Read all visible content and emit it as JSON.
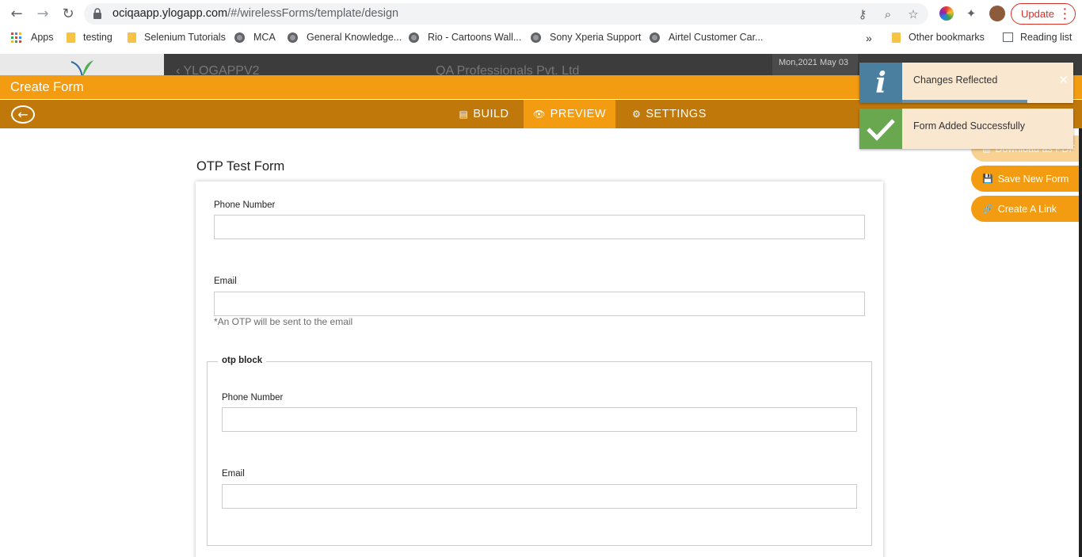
{
  "browser": {
    "url_host": "ociqaapp.ylogapp.com",
    "url_path": "/#/wirelessForms/template/design",
    "update_label": "Update",
    "bookmarks": [
      {
        "label": "Apps",
        "icon": "apps-grid-icon"
      },
      {
        "label": "testing",
        "icon": "folder-icon"
      },
      {
        "label": "Selenium Tutorials",
        "icon": "folder-icon"
      },
      {
        "label": "MCA",
        "icon": "globe-icon"
      },
      {
        "label": "General Knowledge...",
        "icon": "globe-icon"
      },
      {
        "label": "Rio - Cartoons Wall...",
        "icon": "globe-icon"
      },
      {
        "label": "Sony Xperia Support",
        "icon": "globe-icon"
      },
      {
        "label": "Airtel Customer Car...",
        "icon": "globe-icon"
      }
    ],
    "bookmarks_overflow": "»",
    "other_bookmarks": "Other bookmarks",
    "reading_list": "Reading list"
  },
  "app_header": {
    "back_text": "YLOGAPPV2",
    "company": "QA Professionals Pvt. Ltd",
    "date": "Mon,2021 May 03"
  },
  "create_form": {
    "title": "Create Form",
    "tabs": [
      {
        "label": "BUILD",
        "icon": "build-icon",
        "active": false
      },
      {
        "label": "PREVIEW",
        "icon": "eye-icon",
        "active": true
      },
      {
        "label": "SETTINGS",
        "icon": "gear-icon",
        "active": false
      }
    ]
  },
  "form": {
    "title": "OTP Test Form",
    "fields": [
      {
        "label": "Phone Number",
        "value": ""
      },
      {
        "label": "Email",
        "value": "",
        "hint": "*An OTP will be sent to the email"
      }
    ],
    "otp_block": {
      "legend": "otp block",
      "fields": [
        {
          "label": "Phone Number",
          "value": ""
        },
        {
          "label": "Email",
          "value": ""
        }
      ]
    }
  },
  "actions": {
    "download_pdf": "Download as PDF",
    "save_new_form": "Save New Form",
    "create_link": "Create A Link"
  },
  "toasts": [
    {
      "type": "info",
      "message": "Changes Reflected",
      "color": "#4a7fa0"
    },
    {
      "type": "success",
      "message": "Form Added Successfully",
      "color": "#6aa84f"
    }
  ],
  "colors": {
    "accent": "#f39c12",
    "accent_dark": "#c1780b"
  }
}
